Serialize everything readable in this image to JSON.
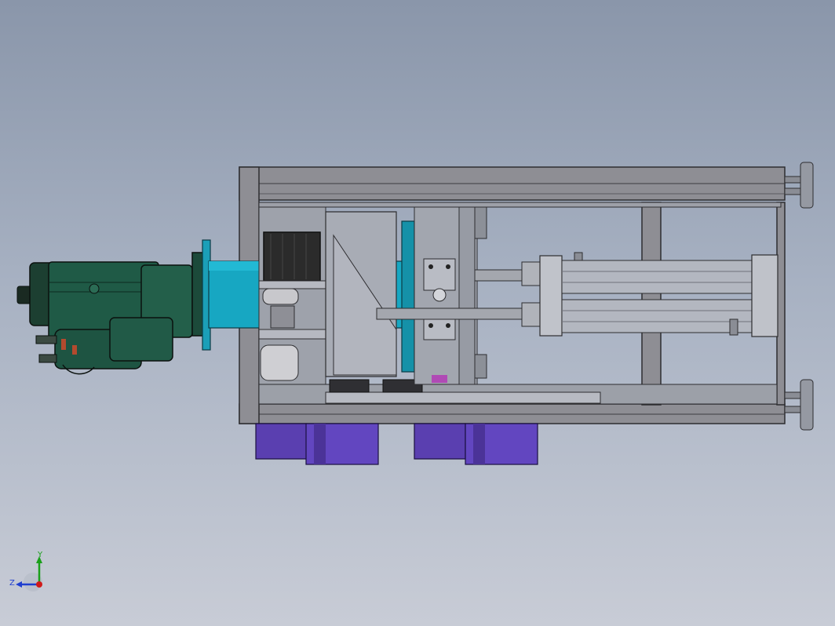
{
  "viewport": {
    "background_top": "#8a96aa",
    "background_bottom": "#c8ccd6"
  },
  "model": {
    "frame_color": "#8e8e94",
    "motor_color": "#1f5a46",
    "coupling_color": "#17a7c2",
    "wheel_color": "#5a3fb0",
    "cylinder_color": "#b3b7c0",
    "block_color": "#a8acb5",
    "stepper_color": "#2b2b2b"
  },
  "triad": {
    "y_label": "Y",
    "z_label": "Z",
    "y_color": "#1aa01a",
    "z_color": "#1f3fd0",
    "origin_color": "#d01a1a"
  }
}
